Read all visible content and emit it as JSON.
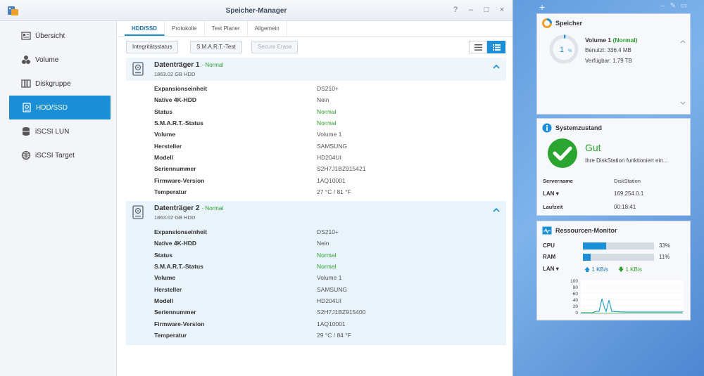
{
  "window": {
    "title": "Speicher-Manager",
    "controls": [
      "?",
      "–",
      "□",
      "×"
    ]
  },
  "sidebar": {
    "items": [
      {
        "label": "Übersicht",
        "icon": "overview-icon"
      },
      {
        "label": "Volume",
        "icon": "volume-icon"
      },
      {
        "label": "Diskgruppe",
        "icon": "diskgroup-icon"
      },
      {
        "label": "HDD/SSD",
        "icon": "hdd-icon",
        "active": true
      },
      {
        "label": "iSCSI LUN",
        "icon": "lun-icon"
      },
      {
        "label": "iSCSI Target",
        "icon": "target-icon"
      }
    ]
  },
  "tabs": [
    "HDD/SSD",
    "Protokolle",
    "Test Planer",
    "Allgemein"
  ],
  "toolbar": {
    "integrity": "Integritätsstatus",
    "smart": "S.M.A.R.T.-Test",
    "erase": "Secure Erase"
  },
  "disks": [
    {
      "name": "Datenträger 1",
      "status": "- Normal",
      "capacity": "1863.02 GB HDD",
      "rows": [
        {
          "k": "Expansionseinheit",
          "v": "DS210+"
        },
        {
          "k": "Native 4K-HDD",
          "v": "Nein"
        },
        {
          "k": "Status",
          "v": "Normal",
          "ok": true
        },
        {
          "k": "S.M.A.R.T.-Status",
          "v": "Normal",
          "ok": true
        },
        {
          "k": "Volume",
          "v": "Volume 1"
        },
        {
          "k": "Hersteller",
          "v": "SAMSUNG"
        },
        {
          "k": "Modell",
          "v": "HD204UI"
        },
        {
          "k": "Seriennummer",
          "v": "S2H7J1BZ915421"
        },
        {
          "k": "Firmware-Version",
          "v": "1AQ10001"
        },
        {
          "k": "Temperatur",
          "v": "27 °C / 81 °F"
        }
      ]
    },
    {
      "name": "Datenträger 2",
      "status": "- Normal",
      "capacity": "1863.02 GB HDD",
      "rows": [
        {
          "k": "Expansionseinheit",
          "v": "DS210+"
        },
        {
          "k": "Native 4K-HDD",
          "v": "Nein"
        },
        {
          "k": "Status",
          "v": "Normal",
          "ok": true
        },
        {
          "k": "S.M.A.R.T.-Status",
          "v": "Normal",
          "ok": true
        },
        {
          "k": "Volume",
          "v": "Volume 1"
        },
        {
          "k": "Hersteller",
          "v": "SAMSUNG"
        },
        {
          "k": "Modell",
          "v": "HD204UI"
        },
        {
          "k": "Seriennummer",
          "v": "S2H7J1BZ915400"
        },
        {
          "k": "Firmware-Version",
          "v": "1AQ10001"
        },
        {
          "k": "Temperatur",
          "v": "29 °C / 84 °F"
        }
      ]
    }
  ],
  "widgets": {
    "storage": {
      "title": "Speicher",
      "volume_name": "Volume 1",
      "volume_status": "(Normal)",
      "used": "Benutzt: 336.4 MB",
      "available": "Verfügbar: 1.79 TB",
      "percent_num": "1",
      "percent_sign": "%",
      "usage_fraction": 0.01
    },
    "health": {
      "title": "Systemzustand",
      "state": "Gut",
      "message": "Ihre DiskStation funktioniert ein...",
      "server_label": "Servername",
      "server_value": "DiskStation",
      "lan_label": "LAN",
      "lan_value": "169.254.0.1",
      "uptime_label": "Laufzeit",
      "uptime_value": "00:18:41"
    },
    "resources": {
      "title": "Ressourcen-Monitor",
      "cpu_label": "CPU",
      "cpu_value": "33%",
      "cpu_fraction": 0.33,
      "ram_label": "RAM",
      "ram_value": "11%",
      "ram_fraction": 0.11,
      "lan_label": "LAN",
      "up": "1 KB/s",
      "down": "1 KB/s",
      "y_ticks": [
        "100",
        "80",
        "60",
        "40",
        "20",
        "0"
      ]
    }
  },
  "colors": {
    "accent": "#1a8fd8",
    "ok": "#2ca02c",
    "health_icon": "#2aa52f"
  }
}
